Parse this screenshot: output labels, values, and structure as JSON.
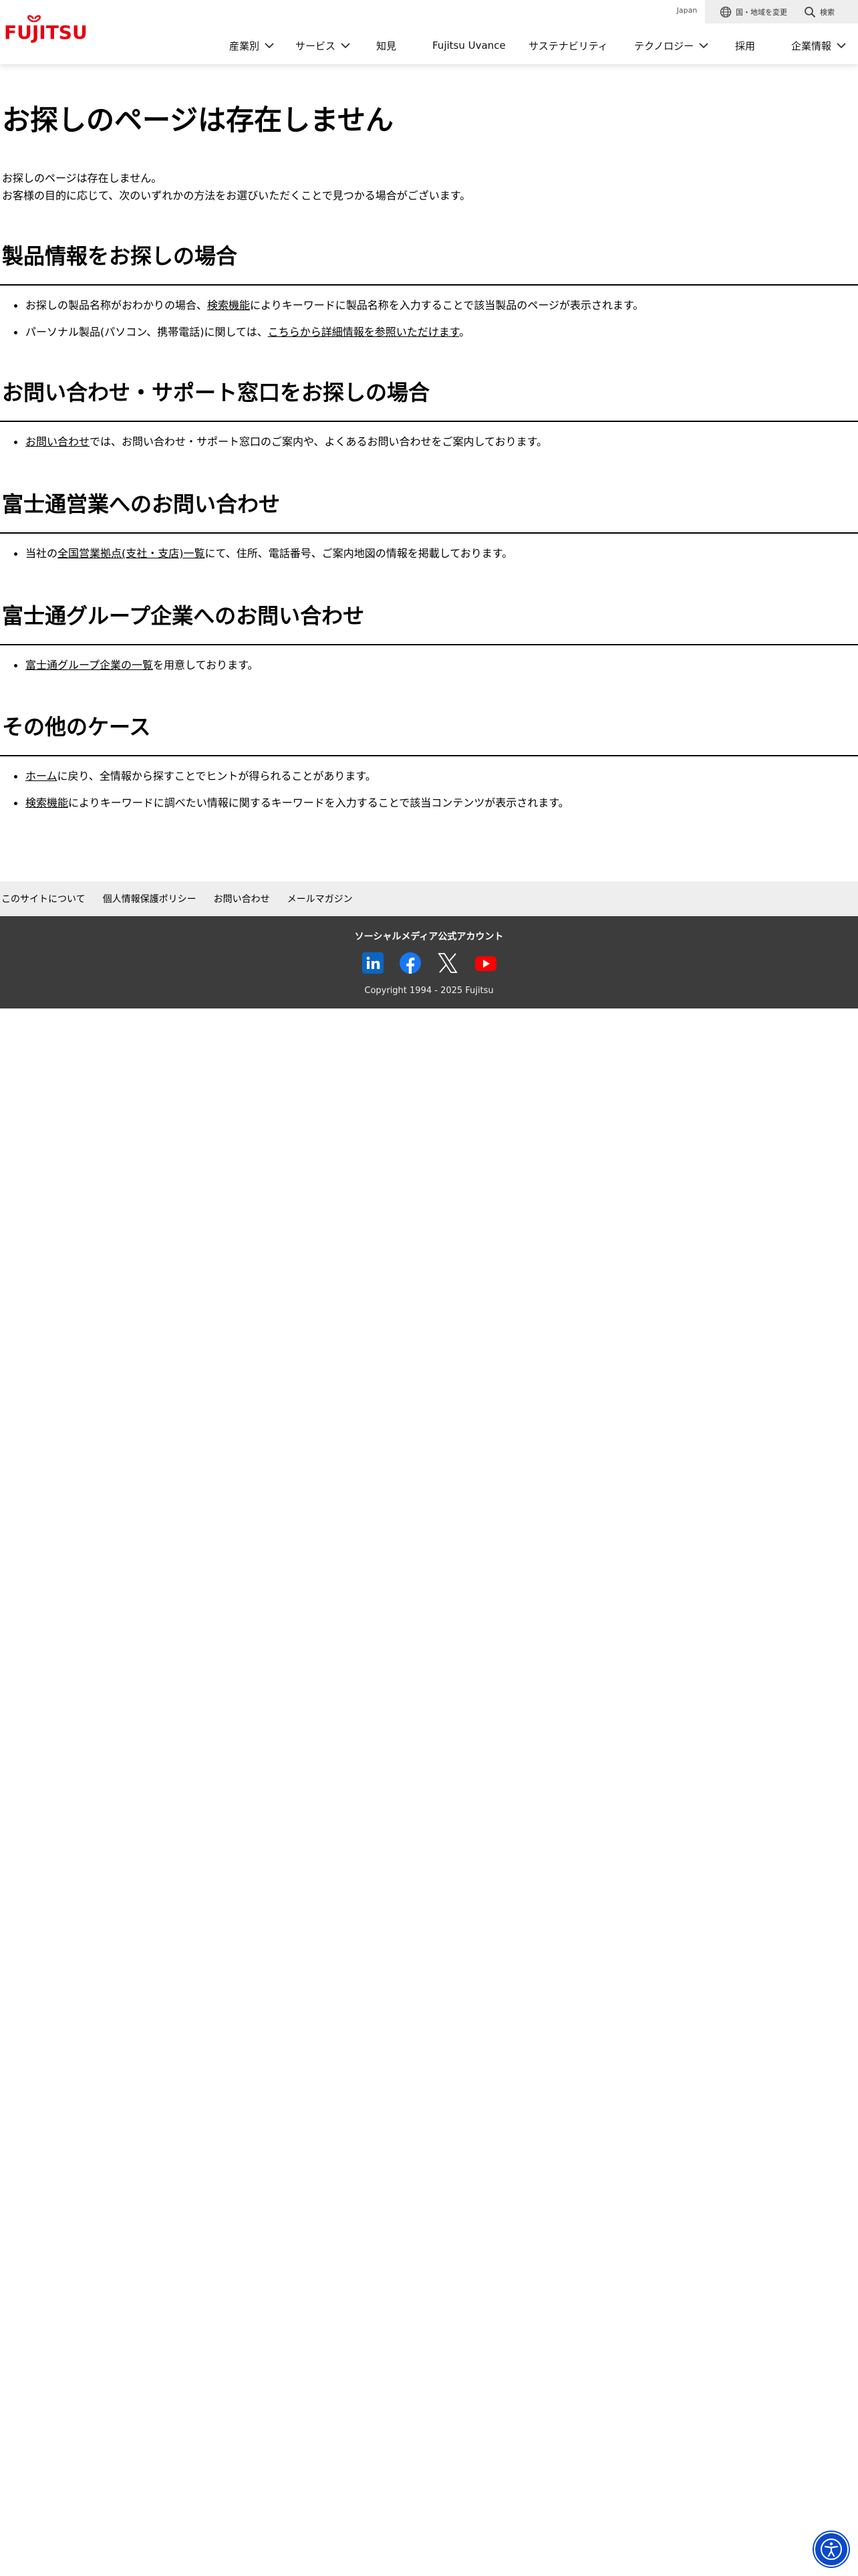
{
  "header": {
    "logo_text": "FUJITSU",
    "country": "Japan",
    "region_label": "国・地域を変更",
    "search_label": "検索",
    "nav": [
      {
        "label": "産業別",
        "dropdown": true
      },
      {
        "label": "サービス",
        "dropdown": true
      },
      {
        "label": "知見",
        "dropdown": false
      },
      {
        "label": "Fujitsu Uvance",
        "dropdown": false
      },
      {
        "label": "サステナビリティ",
        "dropdown": false
      },
      {
        "label": "テクノロジー",
        "dropdown": true
      },
      {
        "label": "採用",
        "dropdown": false
      },
      {
        "label": "企業情報",
        "dropdown": true
      }
    ]
  },
  "main": {
    "title": "お探しのページは存在しません",
    "intro_line1": "お探しのページは存在しません。",
    "intro_line2": "お客様の目的に応じて、次のいずれかの方法をお選びいただくことで見つかる場合がございます。",
    "sections": [
      {
        "heading": "製品情報をお探しの場合",
        "items": [
          {
            "pre": "お探しの製品名称がおわかりの場合、",
            "link": "検索機能",
            "post": "によりキーワードに製品名称を入力することで該当製品のページが表示されます。"
          },
          {
            "pre": "パーソナル製品(パソコン、携帯電話)に関しては、",
            "link": "こちらから詳細情報を参照いただけます",
            "post": "。"
          }
        ]
      },
      {
        "heading": "お問い合わせ・サポート窓口をお探しの場合",
        "items": [
          {
            "pre": "",
            "link": "お問い合わせ",
            "post": "では、お問い合わせ・サポート窓口のご案内や、よくあるお問い合わせをご案内しております。"
          }
        ]
      },
      {
        "heading": "富士通営業へのお問い合わせ",
        "items": [
          {
            "pre": "当社の",
            "link": "全国営業拠点(支社・支店)一覧",
            "post": "にて、住所、電話番号、ご案内地図の情報を掲載しております。"
          }
        ]
      },
      {
        "heading": "富士通グループ企業へのお問い合わせ",
        "items": [
          {
            "pre": "",
            "link": "富士通グループ企業の一覧",
            "post": "を用意しております。"
          }
        ]
      },
      {
        "heading": "その他のケース",
        "items": [
          {
            "pre": "",
            "link": "ホーム",
            "post": "に戻り、全情報から探すことでヒントが得られることがあります。"
          },
          {
            "pre": "",
            "link": "検索機能",
            "post": "によりキーワードに調べたい情報に関するキーワードを入力することで該当コンテンツが表示されます。"
          }
        ]
      }
    ]
  },
  "footer": {
    "links": [
      "このサイトについて",
      "個人情報保護ポリシー",
      "お問い合わせ",
      "メールマガジン"
    ],
    "social_title": "ソーシャルメディア公式アカウント",
    "social_icons": [
      "linkedin-icon",
      "facebook-icon",
      "x-icon",
      "youtube-icon"
    ],
    "copyright": "Copyright 1994 - 2025 Fujitsu"
  },
  "colors": {
    "brand_red": "#e60012",
    "footer_dark": "#3c3c3c",
    "footer_light": "#eeeeee",
    "a11y_blue": "#0b4ac9"
  }
}
